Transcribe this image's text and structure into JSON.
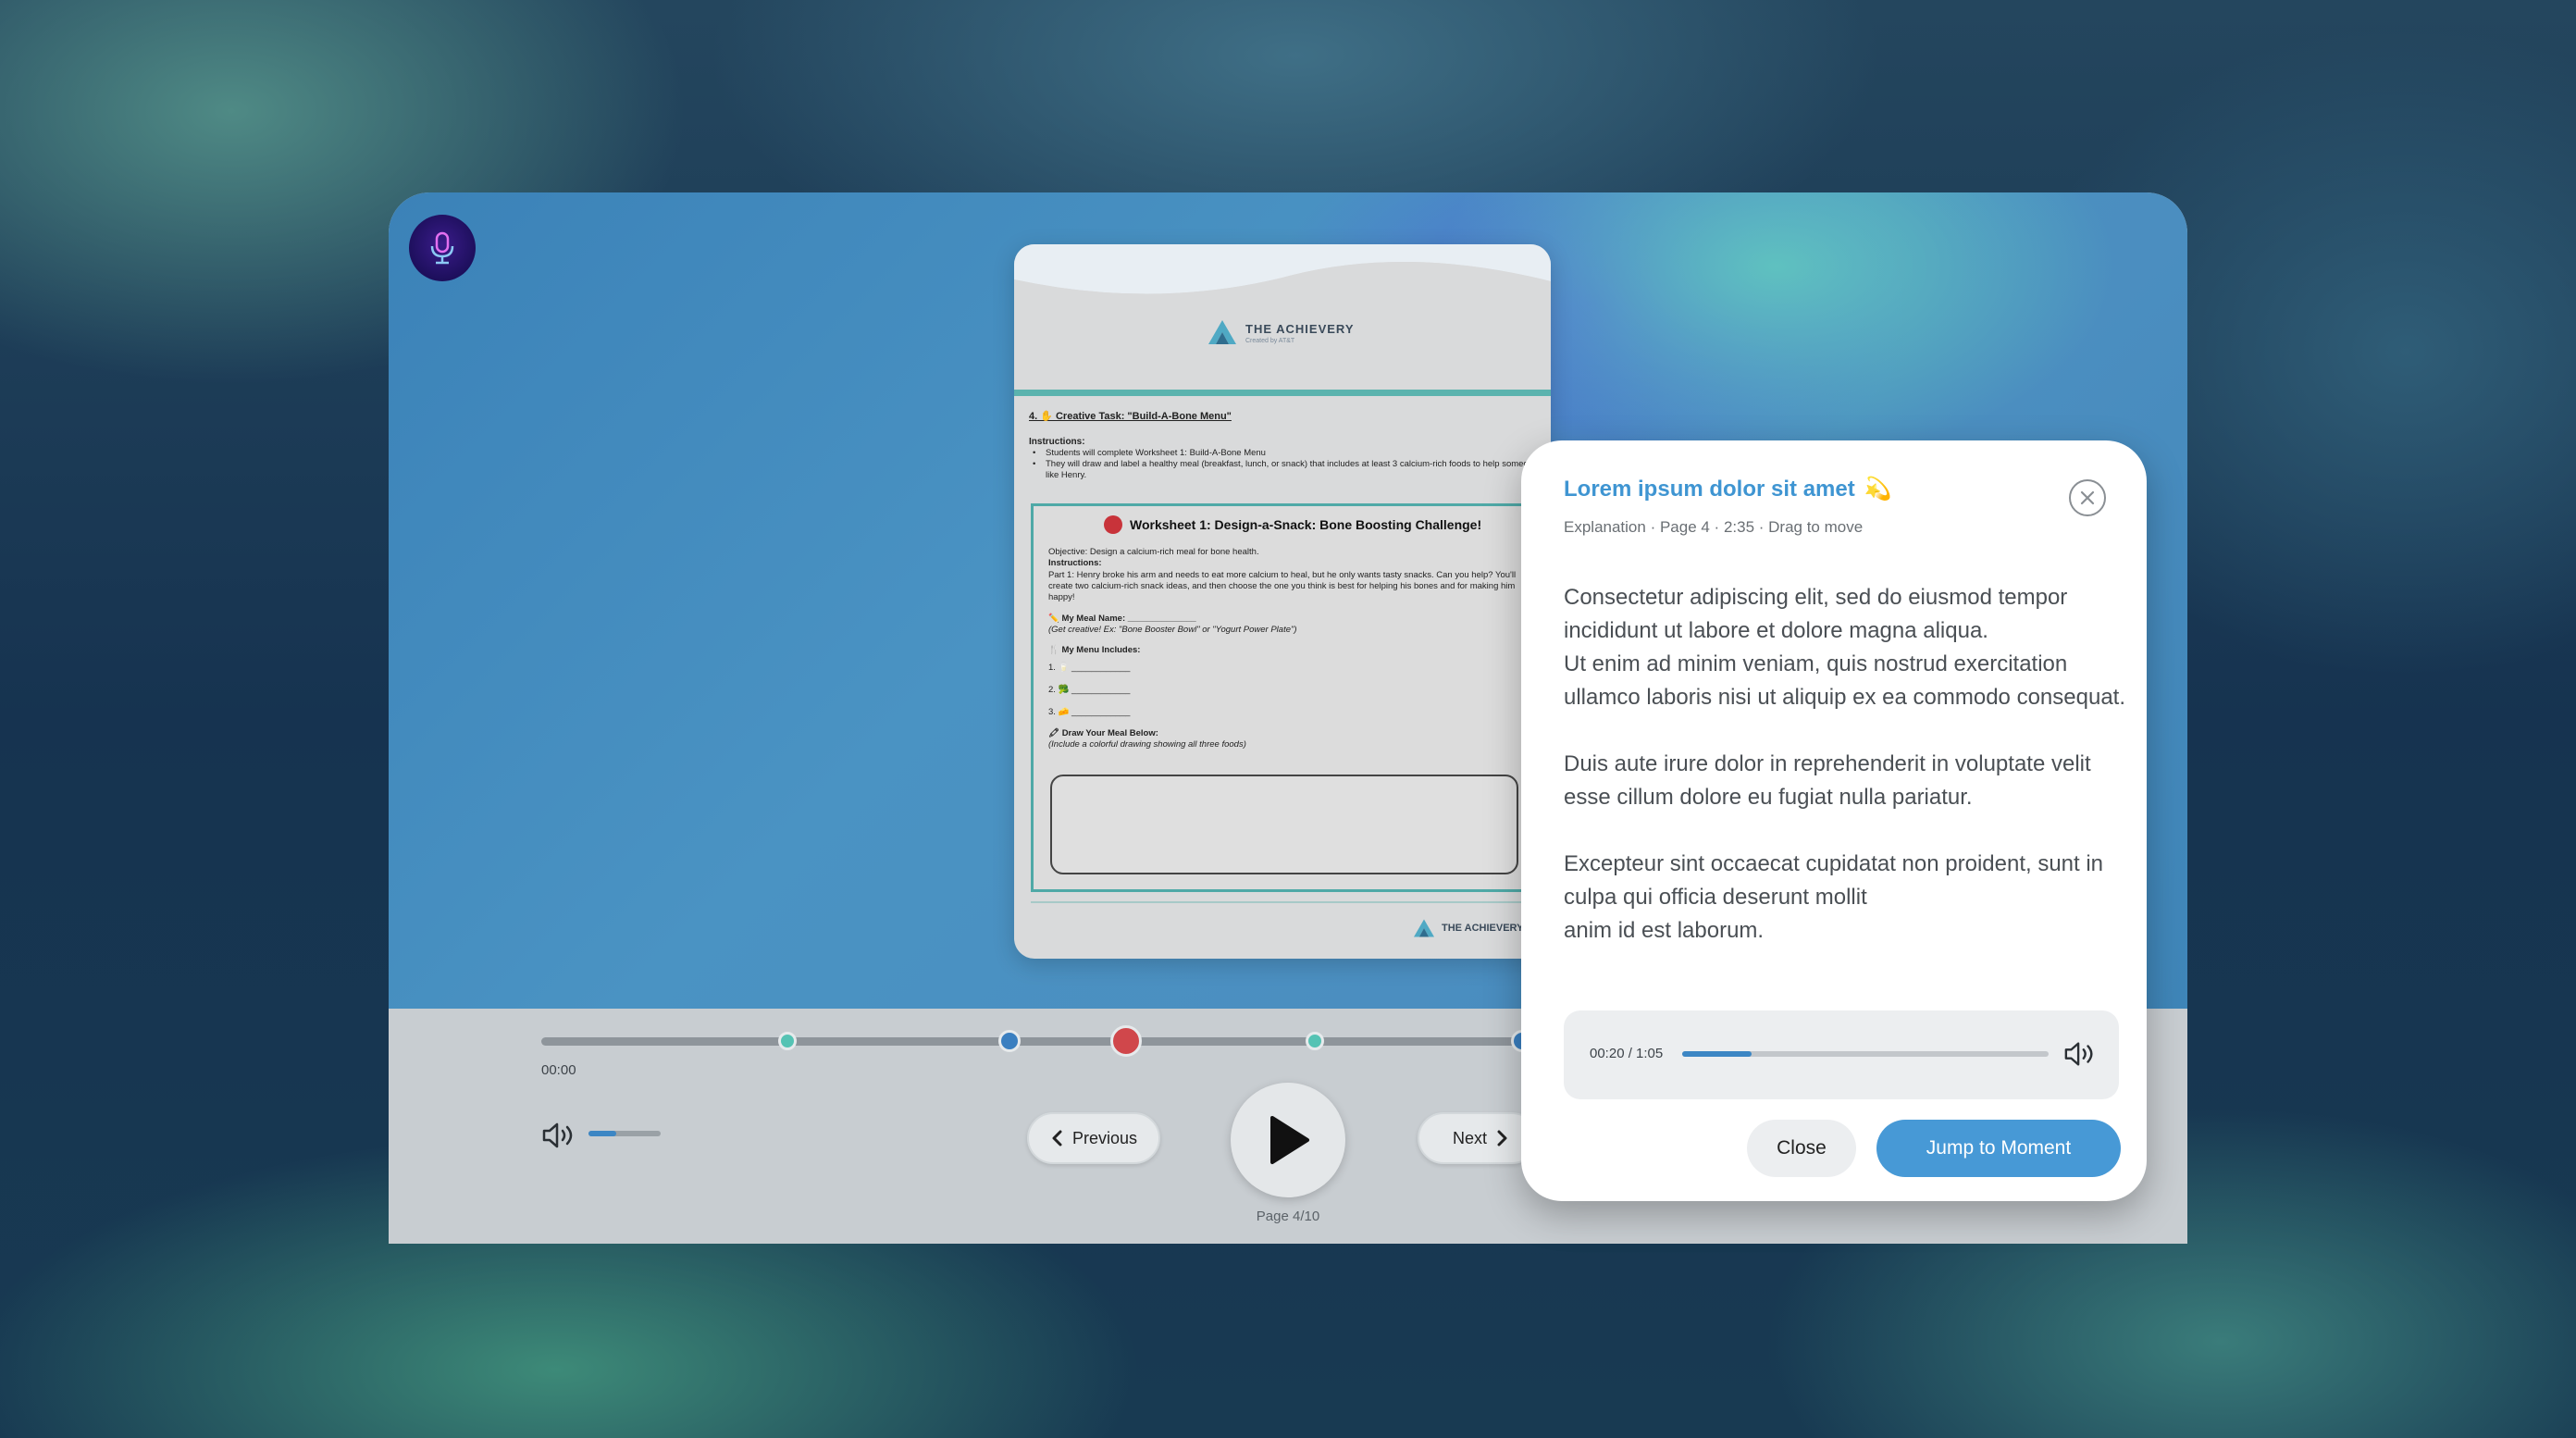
{
  "document": {
    "brand_name": "THE ACHIEVERY",
    "brand_sub": "Created by AT&T",
    "section_heading": "4. ✋ Creative Task: \"Build-A-Bone Menu\"",
    "instructions_label": "Instructions:",
    "instruction_1": "Students will complete Worksheet 1: Build-A-Bone Menu",
    "instruction_2": "They will draw and label a healthy meal (breakfast, lunch, or snack) that includes at least 3 calcium-rich foods to help someone like Henry.",
    "worksheet_title": "Worksheet 1:  Design-a-Snack: Bone Boosting Challenge!",
    "objective": "Objective: Design a calcium-rich meal for bone health.",
    "instructions2_label": "Instructions:",
    "part1": "Part 1: Henry broke his arm and needs to eat more calcium to heal, but he only wants tasty snacks. Can you help? You'll create two calcium-rich snack ideas, and then choose the one you think is best for helping his bones and for making him happy!",
    "meal_name": "✏️ My Meal Name: ______________",
    "meal_hint": "(Get creative! Ex: \"Bone Booster Bowl\" or \"Yogurt Power Plate\")",
    "menu_label": "🍴 My Menu Includes:",
    "menu_1": "1. 🥛 ____________",
    "menu_2": "2. 🥦 ____________",
    "menu_3": "3. 🧀 ____________",
    "draw_label": "🖍 Draw Your Meal Below:",
    "draw_hint": "(Include a colorful drawing showing all three foods)",
    "footer_brand": "THE ACHIEVERY"
  },
  "player": {
    "time_current": "00:00",
    "progress_fraction": 0.0,
    "volume_fraction": 0.38,
    "prev_label": "Previous",
    "next_label": "Next",
    "page_label": "Page 4/10",
    "marker_colors": [
      "#55c3b4",
      "#3a7fc0",
      "#d0474b",
      "#55c3b4",
      "#3a7fc0",
      "#55c3b4"
    ]
  },
  "popup": {
    "title": "Lorem ipsum dolor sit amet",
    "title_emoji": "💫",
    "meta": "Explanation · Page 4 · 2:35 · Drag to move",
    "para1": "Consectetur adipiscing elit, sed do eiusmod tempor incididunt ut labore et dolore magna aliqua.",
    "para1b": "Ut enim ad minim veniam, quis nostrud exercitation ullamco laboris nisi ut aliquip ex ea commodo consequat.",
    "para2": "Duis aute irure dolor in reprehenderit in voluptate velit esse cillum dolore eu fugiat nulla pariatur.",
    "para3": "Excepteur sint occaecat cupidatat non proident, sunt in culpa qui officia deserunt mollit",
    "para3b": "anim id est laborum.",
    "audio_time": "00:20 / 1:05",
    "audio_progress_fraction": 0.19,
    "close_label": "Close",
    "jump_label": "Jump to Moment"
  },
  "colors": {
    "accent": "#4799d6",
    "title_blue": "#3f95d2"
  }
}
